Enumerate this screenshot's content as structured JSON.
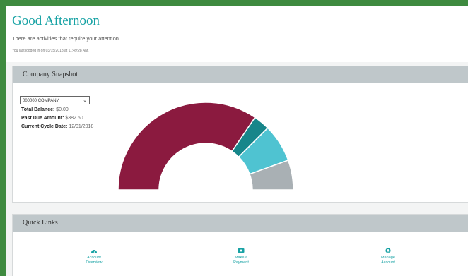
{
  "header": {
    "greeting": "Good Afternoon",
    "attention_text": "There are activities that require your attention.",
    "last_login": "You last logged in on 03/15/2018 at 11:49:28 AM."
  },
  "snapshot": {
    "title": "Company Snapshot",
    "company_select_value": "000000 COMPANY",
    "total_balance_label": "Total Balance:",
    "total_balance_value": "$0.00",
    "past_due_label": "Past Due Amount:",
    "past_due_value": "$382.50",
    "cycle_date_label": "Current Cycle Date:",
    "cycle_date_value": "12/01/2018"
  },
  "chart_data": {
    "type": "pie",
    "shape": "half-donut",
    "slices": [
      {
        "color": "#8b1a3f",
        "value": 69
      },
      {
        "color": "#17868a",
        "value": 6
      },
      {
        "color": "#4fc3d1",
        "value": 14
      },
      {
        "color": "#a9b0b4",
        "value": 11
      }
    ]
  },
  "quick_links": {
    "title": "Quick Links",
    "items": [
      {
        "label_line1": "Account",
        "label_line2": "Overview",
        "icon": "dashboard-icon"
      },
      {
        "label_line1": "Make a",
        "label_line2": "Payment",
        "icon": "payment-icon"
      },
      {
        "label_line1": "Manage",
        "label_line2": "Account",
        "icon": "user-icon"
      }
    ]
  },
  "colors": {
    "accent": "#17a2a4",
    "frame": "#3e8a3f",
    "panel_header": "#bfc7ca"
  }
}
